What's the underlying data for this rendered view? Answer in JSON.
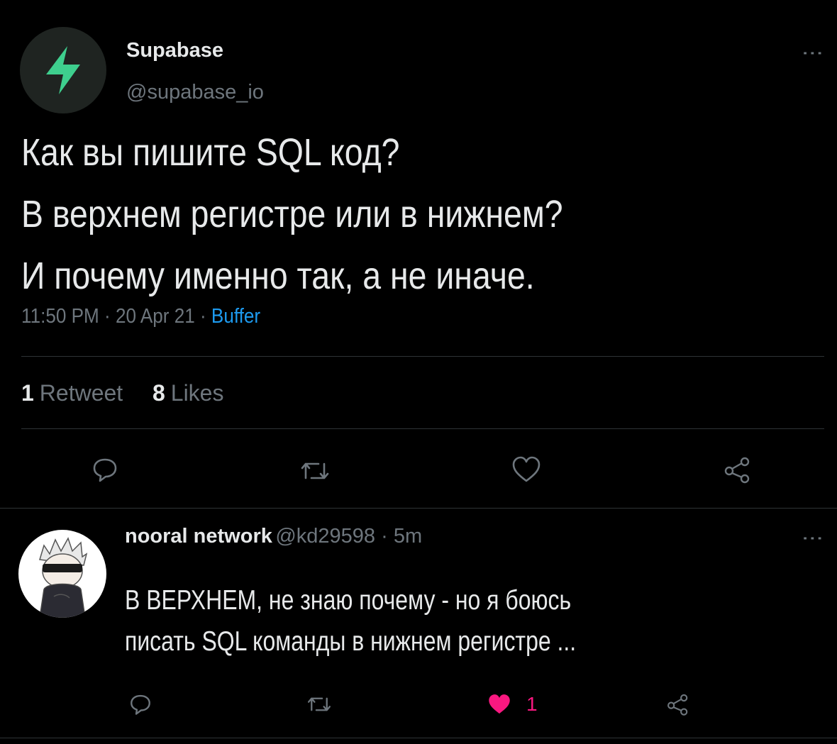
{
  "tweet": {
    "author_name": "Supabase",
    "author_handle": "@supabase_io",
    "text_lines": [
      "Как вы пишите SQL код?",
      "В верхнем регистре или в нижнем?",
      "И почему именно так, а не иначе."
    ],
    "time": "11:50 PM",
    "date": "20 Apr 21",
    "separator": " · ",
    "source": "Buffer",
    "retweet_count": "1",
    "retweet_label": "Retweet",
    "like_count": "8",
    "like_label": "Likes"
  },
  "reply": {
    "author_name": "nooral network",
    "author_handle": "@kd29598",
    "time_ago": "5m",
    "separator": " · ",
    "text_lines": [
      "В ВЕРХНЕМ, не знаю почему - но я боюсь",
      "писать SQL команды в нижнем регистре ..."
    ],
    "like_count": "1"
  },
  "icons": {
    "supabase_logo": "lightning-bolt-icon",
    "more": "more-vertical-icon",
    "reply": "reply-bubble-icon",
    "retweet": "retweet-icon",
    "like": "heart-icon",
    "share": "share-icon"
  },
  "colors": {
    "background": "#000000",
    "text": "#e7e9ea",
    "muted": "#6e767d",
    "link": "#1d9bf0",
    "brand": "#3ecf8e",
    "like_active": "#f91880",
    "divider": "#2f3336"
  }
}
